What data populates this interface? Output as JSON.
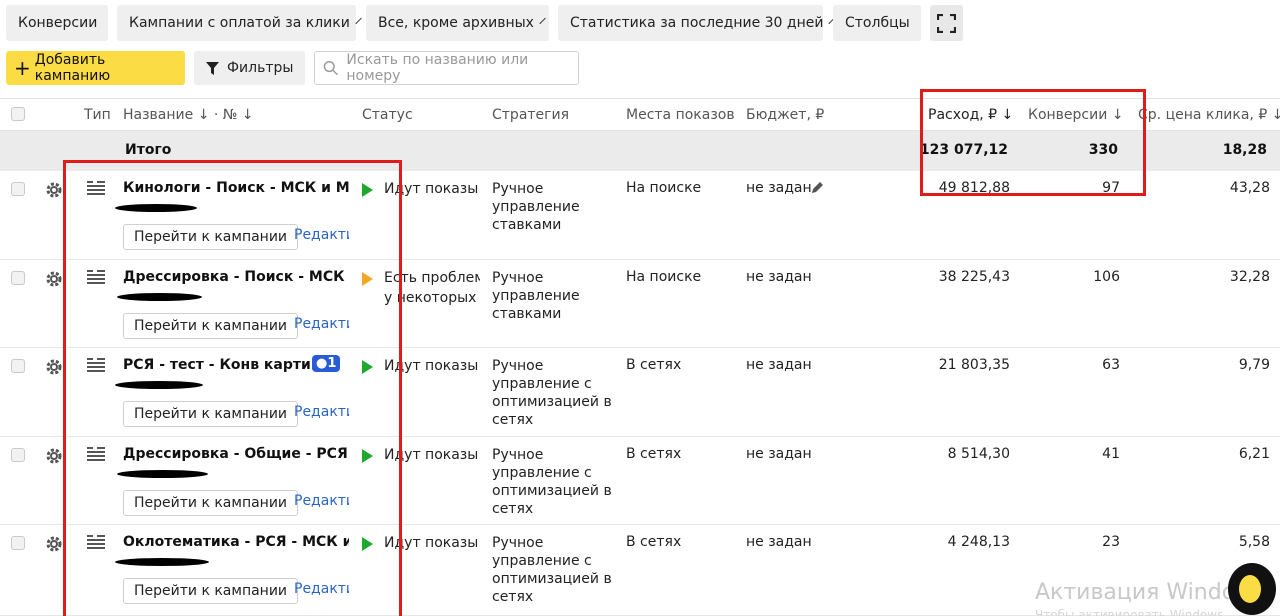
{
  "toolbar": {
    "conversions": "Конверсии",
    "campaign_type": "Кампании с оплатой за клики",
    "archive_filter": "Все, кроме архивных",
    "period": "Статистика за последние 30 дней",
    "columns": "Столбцы",
    "add_campaign": "Добавить кампанию",
    "filters": "Фильтры",
    "search_placeholder": "Искать по названию или номеру"
  },
  "table": {
    "headers": {
      "type": "Тип",
      "name": "Название ↓ · № ↓",
      "status": "Статус",
      "strategy": "Стратегия",
      "places": "Места показов",
      "budget": "Бюджет, ₽",
      "spend": "Расход, ₽ ↓",
      "conversions": "Конверсии ↓",
      "cpc": "Ср. цена клика, ₽ ↓"
    },
    "total": {
      "label": "Итого",
      "spend": "123 077,12",
      "conversions": "330",
      "cpc": "18,28"
    },
    "go_label": "Перейти к кампании",
    "edit_label": "Редактировать",
    "rows": [
      {
        "name": "Кинологи - Поиск - МСК и МО",
        "status": "Идут показы",
        "status_sub": "",
        "strategy": "Ручное управление ставками",
        "places": "На поиске",
        "budget": "не задан",
        "spend": "49 812,88",
        "conversions": "97",
        "cpc": "43,28",
        "badge": ""
      },
      {
        "name": "Дрессировка - Поиск - МСК и МО",
        "status": "Есть проблемы",
        "status_sub": "у некоторых",
        "strategy": "Ручное управление ставками",
        "places": "На поиске",
        "budget": "не задан",
        "spend": "38 225,43",
        "conversions": "106",
        "cpc": "32,28",
        "badge": ""
      },
      {
        "name": "РСЯ - тест - Конв картинка",
        "status": "Идут показы",
        "status_sub": "",
        "strategy": "Ручное управление с оптимизацией в сетях",
        "places": "В сетях",
        "budget": "не задан",
        "spend": "21 803,35",
        "conversions": "63",
        "cpc": "9,79",
        "badge": "1"
      },
      {
        "name": "Дрессировка - Общие - РСЯ - МСК",
        "status": "Идут показы",
        "status_sub": "",
        "strategy": "Ручное управление с оптимизацией в сетях",
        "places": "В сетях",
        "budget": "не задан",
        "spend": "8 514,30",
        "conversions": "41",
        "cpc": "6,21",
        "badge": ""
      },
      {
        "name": "Оклотематика - РСЯ - МСК и МО",
        "status": "Идут показы",
        "status_sub": "",
        "strategy": "Ручное управление с оптимизацией в сетях",
        "places": "В сетях",
        "budget": "не задан",
        "spend": "4 248,13",
        "conversions": "23",
        "cpc": "5,58",
        "badge": ""
      }
    ]
  },
  "watermark": {
    "title": "Активация Windows",
    "sub": "Чтобы активировать Windows"
  }
}
